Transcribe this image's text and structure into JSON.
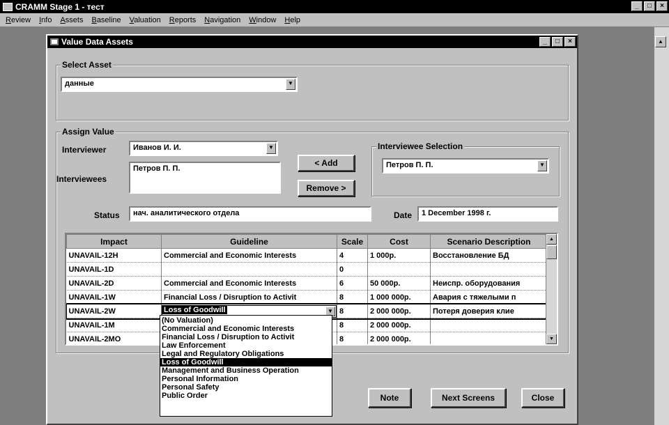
{
  "app": {
    "title": "CRAMM Stage 1 - тест",
    "controls": [
      "_",
      "□",
      "×"
    ]
  },
  "menu": [
    "Review",
    "Info",
    "Assets",
    "Baseline",
    "Valuation",
    "Reports",
    "Navigation",
    "Window",
    "Help"
  ],
  "dialog": {
    "title": "Value Data Assets",
    "controls": [
      "_",
      "□",
      "×"
    ],
    "select_asset": {
      "label": "Select Asset",
      "value": "данные"
    },
    "assign_value": {
      "label": "Assign Value",
      "interviewer_label": "Interviewer",
      "interviewer_value": "Иванов И. И.",
      "interviewees_label": "Interviewees",
      "interviewees_value": "Петров П. П.",
      "add_label": "< Add",
      "remove_label": "Remove >",
      "status_label": "Status",
      "status_value": "нач. аналитического отдела",
      "date_label": "Date",
      "date_value": "1 December 1998 г."
    },
    "interviewee_selection": {
      "label": "Interviewee Selection",
      "value": "Петров П. П."
    },
    "table": {
      "headers": [
        "Impact",
        "Guideline",
        "Scale",
        "Cost",
        "Scenario Description"
      ],
      "rows": [
        [
          "UNAVAIL-12H",
          "Commercial and Economic Interests",
          "4",
          "1 000р.",
          "Восстановление БД"
        ],
        [
          "UNAVAIL-1D",
          "",
          "0",
          "",
          ""
        ],
        [
          "UNAVAIL-2D",
          "Commercial and Economic Interests",
          "6",
          "50 000р.",
          "Неиспр. оборудования"
        ],
        [
          "UNAVAIL-1W",
          "Financial Loss / Disruption to Activit",
          "8",
          "1 000 000р.",
          "Авария с тяжелыми п"
        ],
        [
          "UNAVAIL-2W",
          "Loss of Goodwill",
          "8",
          "2 000 000р.",
          "Потеря доверия клие"
        ],
        [
          "UNAVAIL-1M",
          "",
          "8",
          "2 000 000р.",
          ""
        ],
        [
          "UNAVAIL-2MO",
          "",
          "8",
          "2 000 000р.",
          ""
        ]
      ]
    },
    "guideline_dropdown": {
      "options": [
        "(No Valuation)",
        "Commercial and Economic Interests",
        "Financial Loss / Disruption to Activit",
        "Law Enforcement",
        "Legal and Regulatory Obligations",
        "Loss of Goodwill",
        "Management and Business Operation",
        "Personal Information",
        "Personal Safety",
        "Public Order"
      ],
      "selected": "Loss of Goodwill"
    },
    "buttons": {
      "note": "Note",
      "next": "Next Screens",
      "close": "Close"
    }
  }
}
